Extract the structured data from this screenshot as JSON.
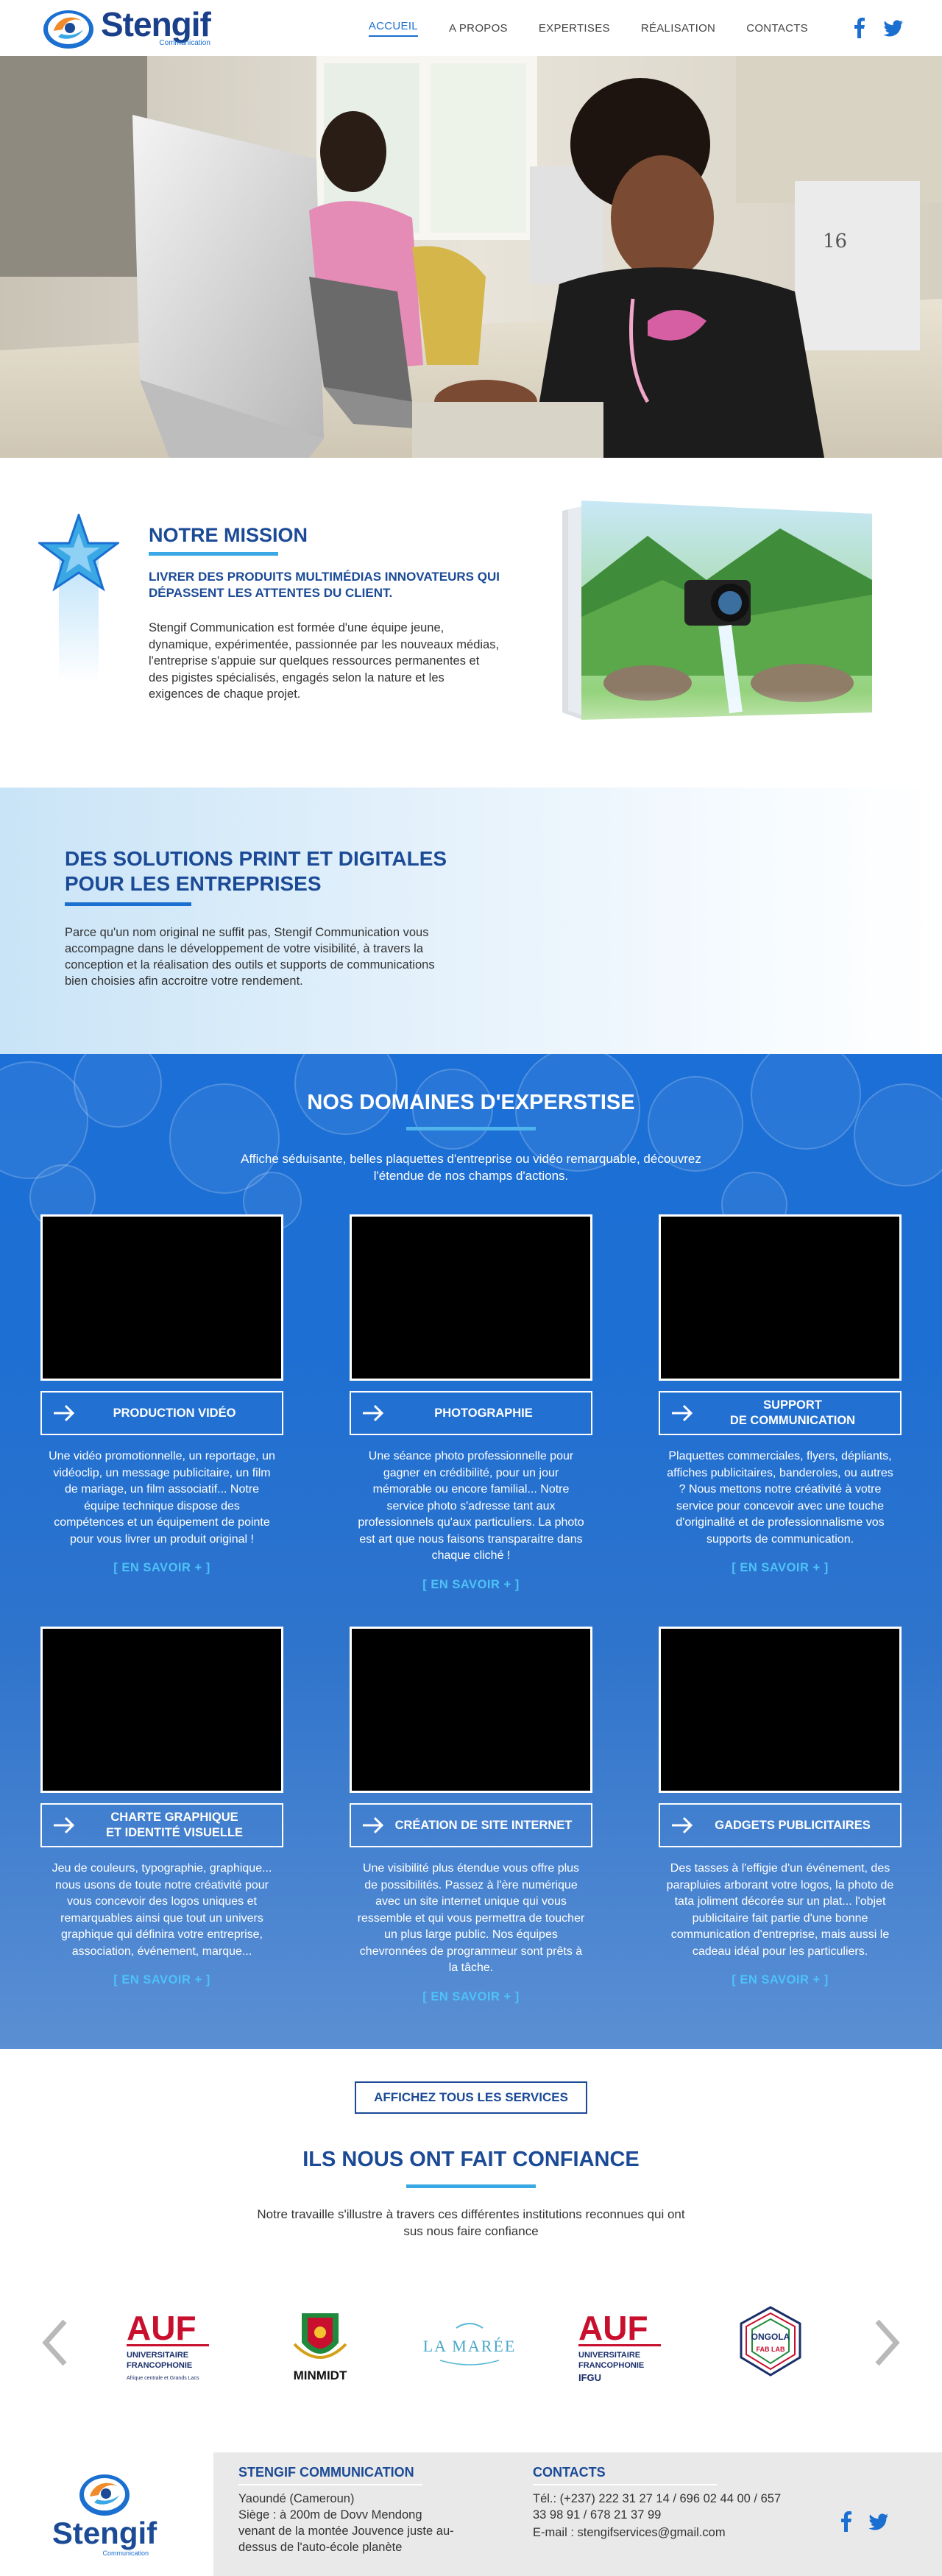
{
  "brand": {
    "name": "Stengif",
    "sub": "Communication",
    "blue": "#1b4a96",
    "accent": "#1a6fd0",
    "light_accent": "#3ba8e6"
  },
  "nav": {
    "items": [
      "ACCUEIL",
      "A PROPOS",
      "EXPERTISES",
      "RÉALISATION",
      "CONTACTS"
    ],
    "active_index": 0,
    "social": [
      "facebook-icon",
      "twitter-icon"
    ]
  },
  "mission": {
    "title": "NOTRE MISSION",
    "lead": "LIVRER DES PRODUITS MULTIMÉDIAS INNOVATEURS QUI DÉPASSENT LES ATTENTES DU CLIENT.",
    "body": "Stengif Communication est formée d'une équipe jeune, dynamique, expérimentée, passionnée par les nouveaux médias, l'entreprise s'appuie sur quelques ressources permanentes et des pigistes spécialisés, engagés selon la nature et les exigences de chaque projet."
  },
  "solutions": {
    "title": "DES SOLUTIONS PRINT ET DIGITALES POUR LES ENTREPRISES",
    "body": "Parce qu'un nom original ne suffit pas, Stengif Communication vous accompagne dans le développement de votre visibilité, à travers la conception et la réalisation des outils et supports de communications bien choisies afin accroitre votre rendement."
  },
  "expertise": {
    "title": "NOS DOMAINES D'EXPERSTISE",
    "subtitle": "Affiche séduisante, belles plaquettes d'entreprise ou vidéo remarquable, découvrez l'étendue de nos champs d'actions.",
    "more_label": "[ EN SAVOIR + ]",
    "cards": [
      {
        "label": "PRODUCTION VIDÉO",
        "desc": "Une vidéo promotionnelle, un reportage, un vidéoclip, un message publicitaire, un film de mariage, un film associatif... Notre équipe technique dispose des compétences et un équipement de pointe pour vous livrer un produit original !"
      },
      {
        "label": "PHOTOGRAPHIE",
        "desc": "Une séance photo professionnelle pour gagner en crédibilité, pour un jour mémorable ou encore familial... Notre service photo s'adresse tant aux professionnels qu'aux particuliers. La photo est art que nous faisons transparaitre dans chaque cliché !"
      },
      {
        "label": "SUPPORT\nDE COMMUNICATION",
        "desc": "Plaquettes commerciales, flyers, dépliants, affiches publicitaires, banderoles, ou autres ? Nous mettons notre créativité à votre service pour concevoir avec une touche d'originalité et de professionnalisme vos supports de communication."
      },
      {
        "label": "CHARTE GRAPHIQUE\nET IDENTITÉ VISUELLE",
        "desc": "Jeu de couleurs, typographie, graphique... nous usons de toute notre créativité pour vous concevoir des logos uniques et remarquables ainsi que tout un univers graphique qui définira votre entreprise, association, événement, marque..."
      },
      {
        "label": "CRÉATION DE SITE INTERNET",
        "desc": "Une visibilité plus étendue vous offre plus de possibilités. Passez à l'ère numérique avec un site internet unique qui vous ressemble et qui vous permettra de toucher un plus large public. Nos équipes chevronnées de programmeur sont prêts à la tâche."
      },
      {
        "label": "GADGETS PUBLICITAIRES",
        "desc": "Des tasses à l'effigie d'un événement, des parapluies arborant votre logos, la photo de tata joliment décorée sur un plat... l'objet publicitaire fait partie d'une bonne communication d'entreprise, mais aussi le cadeau idéal pour les particuliers."
      }
    ]
  },
  "all_services_label": "AFFICHEZ TOUS LES SERVICES",
  "clients": {
    "title": "ILS NOUS ONT FAIT CONFIANCE",
    "subtitle": "Notre travaille s'illustre à travers ces différentes institutions reconnues qui ont sus nous faire confiance",
    "logos": [
      {
        "name": "auf-logo",
        "big": "AUF",
        "line1": "UNIVERSITAIRE",
        "line2": "FRANCOPHONIE",
        "line3": "Afrique centrale et Grands Lacs"
      },
      {
        "name": "minmidt-logo",
        "text": "MINMIDT"
      },
      {
        "name": "la-maree-logo",
        "text": "LA MARÉE"
      },
      {
        "name": "auf-ifgu-logo",
        "big": "AUF",
        "line1": "UNIVERSITAIRE",
        "line2": "FRANCOPHONIE",
        "line3": "IFGU"
      },
      {
        "name": "ongola-fablab-logo",
        "text": "ONGOLA",
        "text2": "FAB LAB"
      }
    ]
  },
  "footer": {
    "company_title": "STENGIF COMMUNICATION",
    "address": "Yaoundé (Cameroun)\nSiège : à 200m de Dovv Mendong venant de la montée Jouvence juste au-dessus de l'auto-école planète",
    "contacts_title": "CONTACTS",
    "phone": "Tél.: (+237) 222 31 27 14 / 696 02 44 00 / 657 33 98 91 / 678 21 37 99",
    "email": "E-mail : stengifservices@gmail.com"
  }
}
